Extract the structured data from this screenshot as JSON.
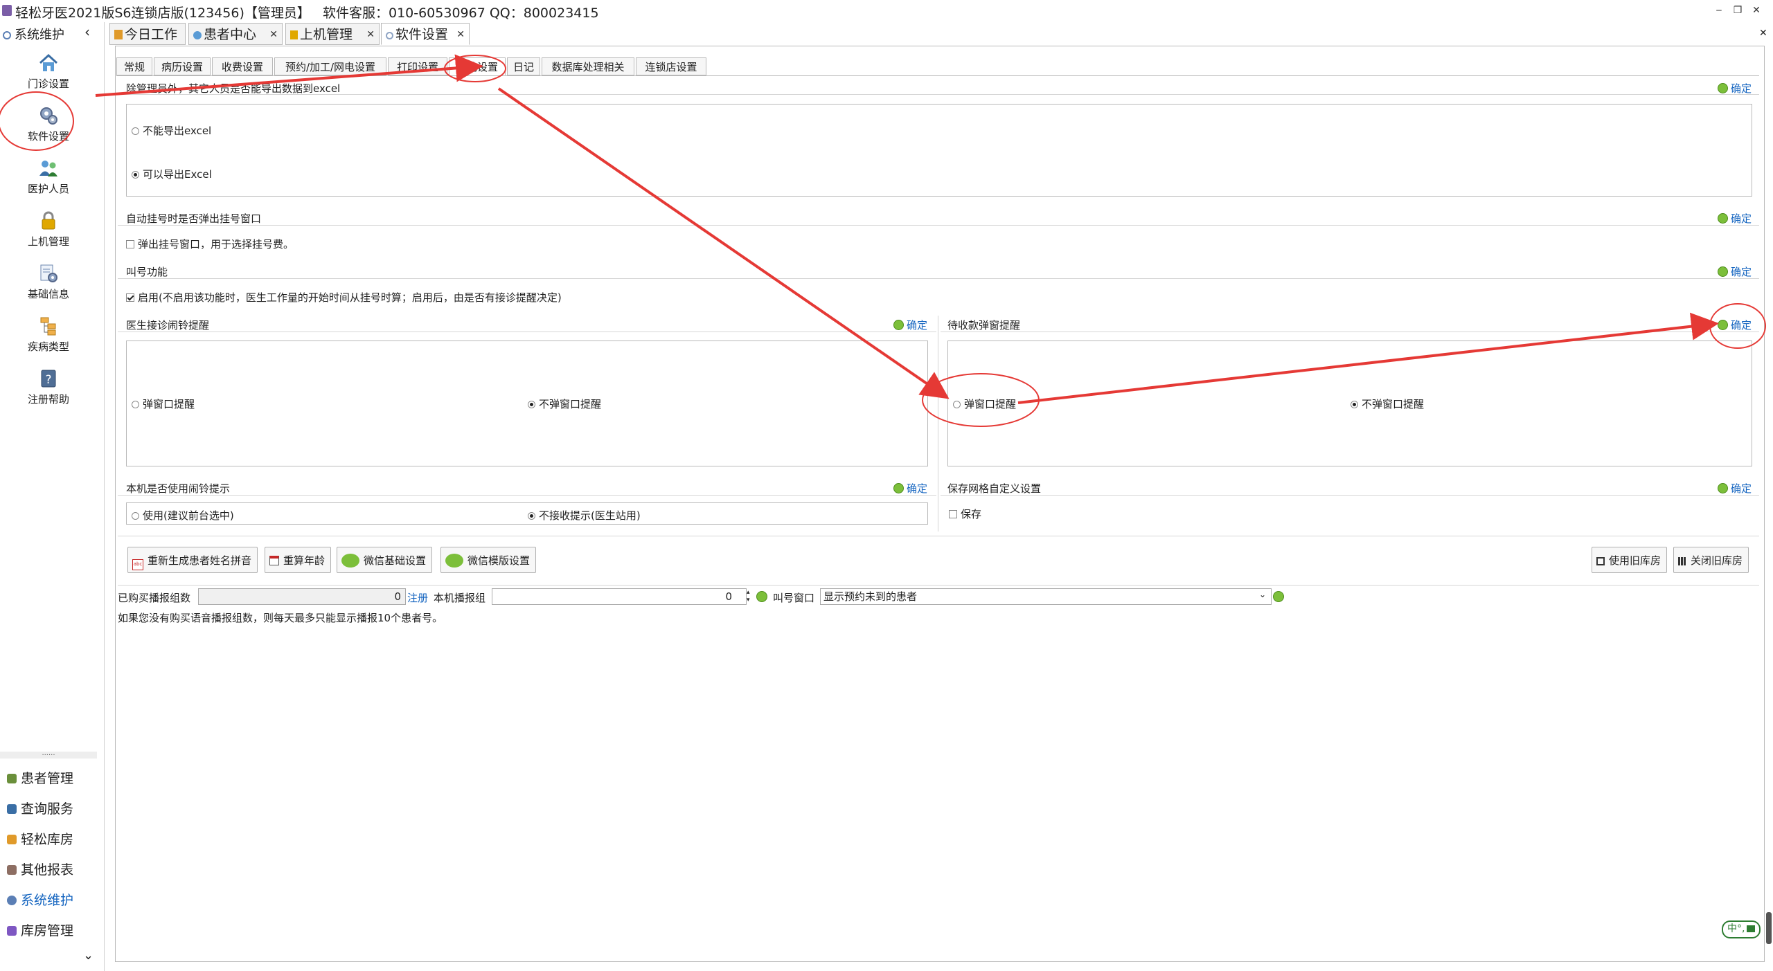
{
  "window": {
    "title": "轻松牙医2021版S6连锁店版(123456)【管理员】   软件客服：010-60530967 QQ：800023415",
    "min_label": "‒",
    "restore_label": "❐",
    "close_label": "✕",
    "close_all_label": "✕"
  },
  "sidebar": {
    "header": "系统维护",
    "collapse": "‹",
    "tools": [
      {
        "label": "门诊设置",
        "icon": "home-icon"
      },
      {
        "label": "软件设置",
        "icon": "gears-icon"
      },
      {
        "label": "医护人员",
        "icon": "staff-icon"
      },
      {
        "label": "上机管理",
        "icon": "lock-icon"
      },
      {
        "label": "基础信息",
        "icon": "settings-doc-icon"
      },
      {
        "label": "疾病类型",
        "icon": "tree-icon"
      },
      {
        "label": "注册帮助",
        "icon": "help-icon"
      }
    ],
    "splitter": "......",
    "nav": [
      {
        "label": "患者管理",
        "icon": "patient-icon",
        "color": "#2e7d32"
      },
      {
        "label": "查询服务",
        "icon": "query-icon",
        "color": "#1565c0"
      },
      {
        "label": "轻松库房",
        "icon": "warehouse-icon",
        "color": "#e65100"
      },
      {
        "label": "其他报表",
        "icon": "report-icon",
        "color": "#6d4c41"
      },
      {
        "label": "系统维护",
        "icon": "system-icon",
        "color": "#1565c0"
      },
      {
        "label": "库房管理",
        "icon": "store-icon",
        "color": "#6a1b9a"
      }
    ],
    "expand": "⌄"
  },
  "doc_tabs": [
    {
      "label": "今日工作",
      "closable": false
    },
    {
      "label": "患者中心",
      "closable": true
    },
    {
      "label": "上机管理",
      "closable": true
    },
    {
      "label": "软件设置",
      "closable": true,
      "active": true
    }
  ],
  "tab_close": "✕",
  "sub_tabs": [
    "常规",
    "病历设置",
    "收费设置",
    "预约/加工/网电设置",
    "打印设置",
    "其他设置",
    "日记",
    "数据库处理相关",
    "连锁店设置"
  ],
  "sub_tab_active": "其他设置",
  "confirm_label": "确定",
  "sections": {
    "export": {
      "title": "除管理员外，其它人员是否能导出数据到excel",
      "options": [
        {
          "label": "不能导出excel",
          "checked": false
        },
        {
          "label": "可以导出Excel",
          "checked": true
        }
      ]
    },
    "auto_register": {
      "title": "自动挂号时是否弹出挂号窗口",
      "checkbox": "弹出挂号窗口，用于选择挂号费。",
      "checked": false
    },
    "calling": {
      "title": "叫号功能",
      "checkbox": "启用(不启用该功能时，医生工作量的开始时间从挂号时算；启用后，由是否有接诊提醒决定)",
      "checked": true
    },
    "doctor_bell": {
      "title": "医生接诊闹铃提醒",
      "options": [
        {
          "label": "弹窗口提醒",
          "checked": false
        },
        {
          "label": "不弹窗口提醒",
          "checked": true
        }
      ]
    },
    "payment_popup": {
      "title": "待收款弹窗提醒",
      "options": [
        {
          "label": "弹窗口提醒",
          "checked": false
        },
        {
          "label": "不弹窗口提醒",
          "checked": true
        }
      ]
    },
    "local_bell": {
      "title": "本机是否使用闹铃提示",
      "options": [
        {
          "label": "使用(建议前台选中)",
          "checked": false
        },
        {
          "label": "不接收提示(医生站用)",
          "checked": true
        }
      ]
    },
    "grid_custom": {
      "title": "保存网格自定义设置",
      "checkbox": "保存",
      "checked": false
    }
  },
  "actions": {
    "regen_pinyin": "重新生成患者姓名拼音",
    "recalc_age": "重算年龄",
    "wechat_basic": "微信基础设置",
    "wechat_template": "微信模版设置",
    "use_old_store": "使用旧库房",
    "close_old_store": "关闭旧库房"
  },
  "broadcast": {
    "purchased_label": "已购买播报组数",
    "purchased_value": "0",
    "register_link": "注册",
    "local_label": "本机播报组",
    "local_value": "0",
    "window_label": "叫号窗口",
    "window_value": "显示预约未到的患者",
    "note": "如果您没有购买语音播报组数，则每天最多只能显示播报10个患者号。"
  },
  "ime_status": "中°,",
  "colors": {
    "annotation_red": "#e53935",
    "link_blue": "#1565c0",
    "ok_green": "#7cbf3a"
  }
}
